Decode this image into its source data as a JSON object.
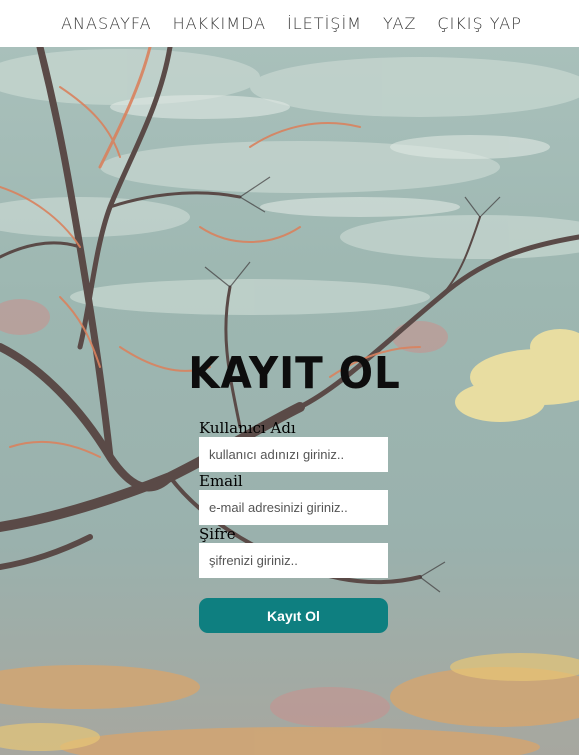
{
  "nav": {
    "items": [
      {
        "label": "ANASAYFA"
      },
      {
        "label": "HAKKIMDA"
      },
      {
        "label": "İLETİŞİM"
      },
      {
        "label": "YAZ"
      },
      {
        "label": "ÇIKIŞ YAP"
      }
    ]
  },
  "form": {
    "title": "KAYIT OL",
    "username": {
      "label": "Kullanıcı Adı",
      "placeholder": "kullanıcı adınızı giriniz..",
      "value": ""
    },
    "email": {
      "label": "Email",
      "placeholder": "e-mail adresinizi giriniz..",
      "value": ""
    },
    "password": {
      "label": "Şifre",
      "placeholder": "şifrenizi giriniz..",
      "value": ""
    },
    "submit_label": "Kayıt Ol"
  },
  "colors": {
    "nav_background": "#ffffff",
    "button_background": "#0e7f80",
    "button_text": "#ffffff"
  }
}
